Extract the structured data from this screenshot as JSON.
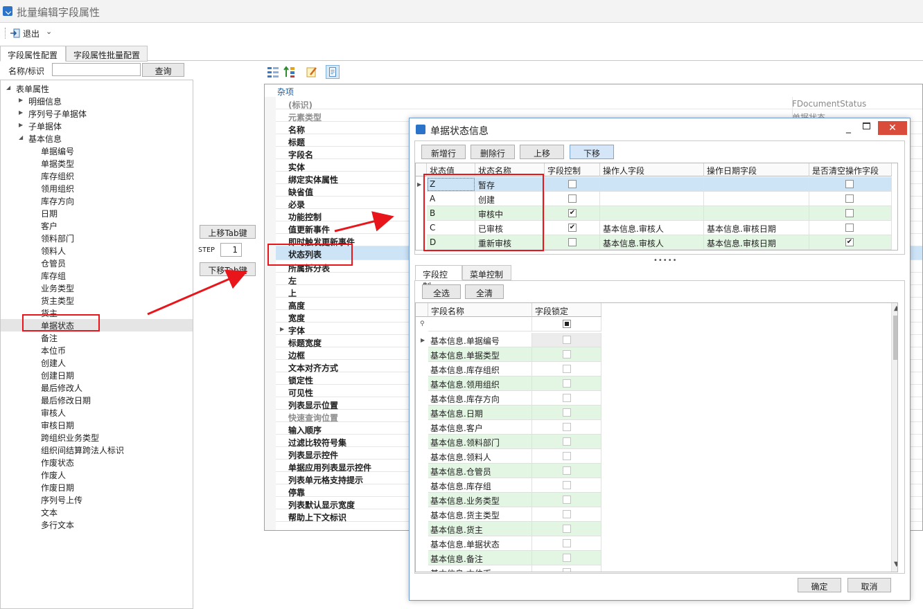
{
  "window": {
    "title": "批量编辑字段属性"
  },
  "toolbar": {
    "exit_label": "退出",
    "dropdown_glyph": "⌄"
  },
  "main_tabs": [
    {
      "label": "字段属性配置"
    },
    {
      "label": "字段属性批量配置"
    }
  ],
  "search": {
    "label": "名称/标识",
    "value": "",
    "button": "查询"
  },
  "tree": {
    "root": "表单属性",
    "groups": [
      "明细信息",
      "序列号子单据体",
      "子单据体",
      "基本信息"
    ],
    "fields": [
      "单据编号",
      "单据类型",
      "库存组织",
      "领用组织",
      "库存方向",
      "日期",
      "客户",
      "领料部门",
      "领料人",
      "仓管员",
      "库存组",
      "业务类型",
      "货主类型",
      "货主",
      "单据状态",
      "备注",
      "本位币",
      "创建人",
      "创建日期",
      "最后修改人",
      "最后修改日期",
      "审核人",
      "审核日期",
      "跨组织业务类型",
      "组织间结算跨法人标识",
      "作废状态",
      "作废人",
      "作废日期",
      "序列号上传",
      "文本",
      "多行文本"
    ]
  },
  "middle": {
    "up_tab": "上移Tab键",
    "down_tab": "下移Tab键",
    "step_label": "STEP",
    "step_value": "1"
  },
  "property_grid": {
    "category": "杂项",
    "rows": [
      {
        "name": "(标识)",
        "value": "FDocumentStatus"
      },
      {
        "name": "元素类型",
        "value": "单据状态"
      },
      {
        "name": "名称"
      },
      {
        "name": "标题"
      },
      {
        "name": "字段名"
      },
      {
        "name": "实体"
      },
      {
        "name": "绑定实体属性"
      },
      {
        "name": "缺省值"
      },
      {
        "name": "必录"
      },
      {
        "name": "功能控制"
      },
      {
        "name": "值更新事件"
      },
      {
        "name": "即时触发更新事件"
      },
      {
        "name": "状态列表"
      },
      {
        "name": "所属拆分表"
      },
      {
        "name": "左"
      },
      {
        "name": "上"
      },
      {
        "name": "高度"
      },
      {
        "name": "宽度"
      },
      {
        "name": "字体"
      },
      {
        "name": "标题宽度"
      },
      {
        "name": "边框"
      },
      {
        "name": "文本对齐方式"
      },
      {
        "name": "锁定性"
      },
      {
        "name": "可见性"
      },
      {
        "name": "列表显示位置"
      },
      {
        "name": "快速查询位置"
      },
      {
        "name": "输入顺序"
      },
      {
        "name": "过滤比较符号集"
      },
      {
        "name": "列表显示控件"
      },
      {
        "name": "单据应用列表显示控件"
      },
      {
        "name": "列表单元格支持提示"
      },
      {
        "name": "停靠"
      },
      {
        "name": "列表默认显示宽度"
      },
      {
        "name": "帮助上下文标识"
      }
    ]
  },
  "dialog": {
    "title": "单据状态信息",
    "close_glyph": "✕",
    "min_glyph": "_",
    "buttons": {
      "add_row": "新增行",
      "delete_row": "删除行",
      "move_up": "上移",
      "move_down": "下移"
    },
    "state_grid": {
      "headers": [
        "状态值",
        "状态名称",
        "字段控制",
        "操作人字段",
        "操作日期字段",
        "是否清空操作字段"
      ],
      "rows": [
        {
          "value": "Z",
          "name": "暂存",
          "control": false,
          "operator": "",
          "date": "",
          "clear": false
        },
        {
          "value": "A",
          "name": "创建",
          "control": false,
          "operator": "",
          "date": "",
          "clear": false
        },
        {
          "value": "B",
          "name": "审核中",
          "control": true,
          "operator": "",
          "date": "",
          "clear": false
        },
        {
          "value": "C",
          "name": "已审核",
          "control": true,
          "operator": "基本信息.审核人",
          "date": "基本信息.审核日期",
          "clear": false
        },
        {
          "value": "D",
          "name": "重新审核",
          "control": false,
          "operator": "基本信息.审核人",
          "date": "基本信息.审核日期",
          "clear": true
        }
      ]
    },
    "splitter": "•••••",
    "lower_tabs": [
      {
        "label": "字段控制"
      },
      {
        "label": "菜单控制"
      }
    ],
    "select_all": "全选",
    "clear_all": "全清",
    "field_grid": {
      "headers": [
        "字段名称",
        "字段锁定"
      ],
      "rows": [
        "基本信息.单据编号",
        "基本信息.单据类型",
        "基本信息.库存组织",
        "基本信息.领用组织",
        "基本信息.库存方向",
        "基本信息.日期",
        "基本信息.客户",
        "基本信息.领料部门",
        "基本信息.领料人",
        "基本信息.仓管员",
        "基本信息.库存组",
        "基本信息.业务类型",
        "基本信息.货主类型",
        "基本信息.货主",
        "基本信息.单据状态",
        "基本信息.备注",
        "基本信息.本位币"
      ]
    },
    "ok": "确定",
    "cancel": "取消"
  },
  "colors": {
    "accent_red": "#e8161b",
    "row_green": "#e3f5e3",
    "row_selected": "#cde4f7"
  }
}
